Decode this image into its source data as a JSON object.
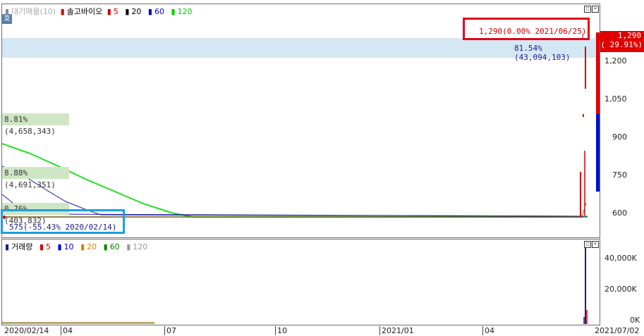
{
  "main_legend": {
    "prefix_icon": "▮",
    "volume_profile_label": "대기매물(10)",
    "series_label": "솔고바이오",
    "ma": [
      {
        "label": "5",
        "color": "#d40000"
      },
      {
        "label": "20",
        "color": "#000000"
      },
      {
        "label": "60",
        "color": "#0000cc"
      },
      {
        "label": "120",
        "color": "#00cc00"
      }
    ]
  },
  "toggle_button": "호",
  "max_annotation": "1,290(0.00% 2021/06/25)",
  "min_annotation": "575(-55.43% 2020/02/14)",
  "current_price": {
    "value": "1,290",
    "change": "( 29.91%)",
    "color": "#d80000"
  },
  "volume_profile_bars": [
    {
      "text": "81.54% (43,094,103)",
      "price_level": "top"
    },
    {
      "text": "8.81% (4,658,343)"
    },
    {
      "text": "8.88% (4,691,351)"
    },
    {
      "text": "0.76% (403,832)"
    }
  ],
  "price_axis": [
    "1,200",
    "1,050",
    "900",
    "750",
    "600"
  ],
  "volume_legend": {
    "label": "거래량",
    "ma": [
      {
        "label": "5",
        "color": "#d40000"
      },
      {
        "label": "10",
        "color": "#0000cc"
      },
      {
        "label": "20",
        "color": "#e08000"
      },
      {
        "label": "60",
        "color": "#008800"
      },
      {
        "label": "120",
        "color": "#999999"
      }
    ]
  },
  "volume_axis": [
    "40,000K",
    "20,000K",
    "0K"
  ],
  "x_axis": {
    "start": "2020/02/14",
    "ticks": [
      "04",
      "07",
      "10",
      "2021/01",
      "04"
    ],
    "end": "2021/07/02"
  },
  "chart_data": {
    "type": "line",
    "title": "솔고바이오",
    "x_range": [
      "2020/02/14",
      "2021/07/02"
    ],
    "price_ylim": [
      540,
      1290
    ],
    "max_point": {
      "x": "2021/06/25",
      "y": 1290
    },
    "min_point": {
      "x": "2020/02/14",
      "y": 575
    },
    "last_price": 1290,
    "last_change_pct": 29.91,
    "volume_ylim_k": [
      0,
      45000
    ]
  }
}
